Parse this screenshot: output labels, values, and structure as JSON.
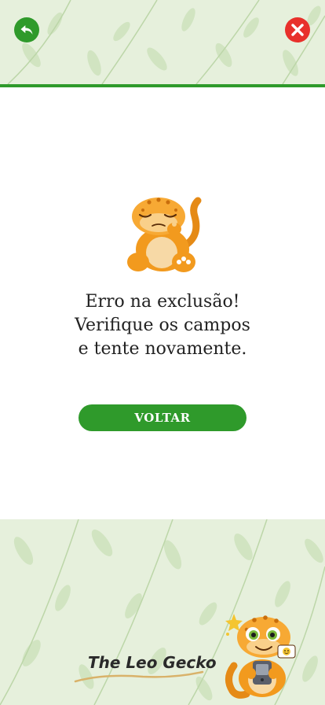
{
  "header": {
    "back_icon": "back-arrow-icon",
    "close_icon": "close-x-icon",
    "close_glyph": "X"
  },
  "main": {
    "message_lines": [
      "Erro na exclusão!",
      "Verifique os campos",
      "e tente novamente."
    ],
    "button_label": "VOLTAR"
  },
  "footer": {
    "brand_text": "The Leo Gecko"
  },
  "colors": {
    "accent_green": "#2f9a2b",
    "close_red": "#e8302b",
    "leaf_bg": "#e6f0dc",
    "gecko_orange": "#f29a1e"
  }
}
